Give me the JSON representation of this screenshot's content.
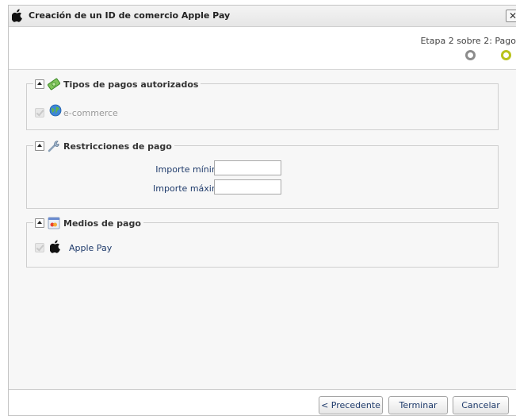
{
  "window": {
    "title": "Creación de un ID de comercio Apple Pay",
    "close_label": "✕"
  },
  "wizard": {
    "step_label": "Etapa 2 sobre 2: Pago",
    "steps": [
      {
        "state": "completed",
        "color": "#8c8c8c"
      },
      {
        "state": "current",
        "color": "#b9c31c"
      }
    ]
  },
  "sections": {
    "payment_types": {
      "title": "Tipos de pagos autorizados",
      "items": [
        {
          "label": "e-commerce",
          "checked": true,
          "disabled": true
        }
      ]
    },
    "restrictions": {
      "title": "Restricciones de pago",
      "min_label": "Importe mínimo:",
      "min_value": "",
      "max_label": "Importe máximo:",
      "max_value": ""
    },
    "payment_methods": {
      "title": "Medios de pago",
      "items": [
        {
          "label": "Apple Pay",
          "checked": true,
          "disabled": true
        }
      ]
    }
  },
  "footer": {
    "previous_label": "< Precedente",
    "finish_label": "Terminar",
    "cancel_label": "Cancelar"
  },
  "colors": {
    "accent_step": "#b9c31c",
    "link_text": "#1f3b6b",
    "panel_bg": "#f7f7f7"
  }
}
